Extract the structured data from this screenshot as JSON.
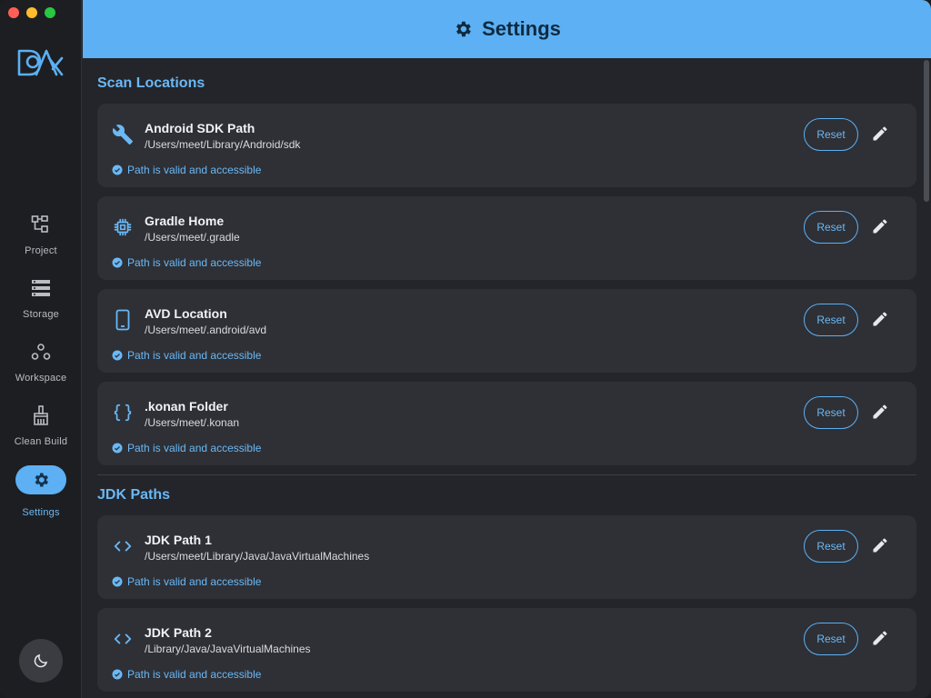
{
  "window": {
    "header_title": "Settings"
  },
  "sidebar": {
    "items": [
      {
        "label": "Project",
        "icon": "project-icon",
        "active": false
      },
      {
        "label": "Storage",
        "icon": "storage-icon",
        "active": false
      },
      {
        "label": "Workspace",
        "icon": "workspace-icon",
        "active": false
      },
      {
        "label": "Clean Build",
        "icon": "broom-icon",
        "active": false
      },
      {
        "label": "Settings",
        "icon": "gear-icon",
        "active": true
      }
    ],
    "theme_toggle_icon": "moon-icon"
  },
  "sections": {
    "scan": {
      "title": "Scan Locations",
      "items": [
        {
          "name": "Android SDK Path",
          "path": "/Users/meet/Library/Android/sdk",
          "status": "Path is valid and accessible",
          "icon": "wrench-icon",
          "reset": "Reset"
        },
        {
          "name": "Gradle Home",
          "path": "/Users/meet/.gradle",
          "status": "Path is valid and accessible",
          "icon": "chip-icon",
          "reset": "Reset"
        },
        {
          "name": "AVD Location",
          "path": "/Users/meet/.android/avd",
          "status": "Path is valid and accessible",
          "icon": "phone-icon",
          "reset": "Reset"
        },
        {
          "name": ".konan Folder",
          "path": "/Users/meet/.konan",
          "status": "Path is valid and accessible",
          "icon": "braces-icon",
          "reset": "Reset"
        }
      ]
    },
    "jdk": {
      "title": "JDK Paths",
      "items": [
        {
          "name": "JDK Path 1",
          "path": "/Users/meet/Library/Java/JavaVirtualMachines",
          "status": "Path is valid and accessible",
          "icon": "code-icon",
          "reset": "Reset"
        },
        {
          "name": "JDK Path 2",
          "path": "/Library/Java/JavaVirtualMachines",
          "status": "Path is valid and accessible",
          "icon": "code-icon",
          "reset": "Reset"
        }
      ]
    }
  },
  "colors": {
    "accent": "#5cb0f3",
    "header_text": "#0f2a40",
    "card": "#2e3036",
    "background": "#23252a"
  }
}
